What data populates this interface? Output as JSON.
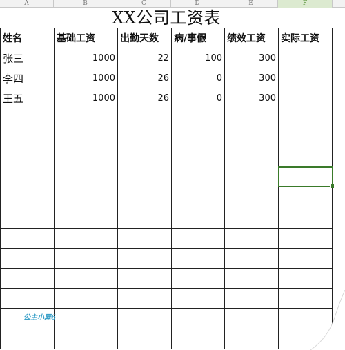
{
  "columns": [
    "A",
    "B",
    "C",
    "D",
    "E",
    "F"
  ],
  "active_column": "F",
  "title": "XX公司工资表",
  "headers": [
    "姓名",
    "基础工资",
    "出勤天数",
    "病/事假",
    "绩效工资",
    "实际工资"
  ],
  "rows": [
    [
      "张三",
      "1000",
      "22",
      "100",
      "300",
      ""
    ],
    [
      "李四",
      "1000",
      "26",
      "0",
      "300",
      ""
    ],
    [
      "王五",
      "1000",
      "26",
      "0",
      "300",
      ""
    ]
  ],
  "watermark": "公主小屋6",
  "colors": {
    "selection": "#3a7a2a",
    "grid": "#222222",
    "watermark": "#3aa0c8"
  }
}
